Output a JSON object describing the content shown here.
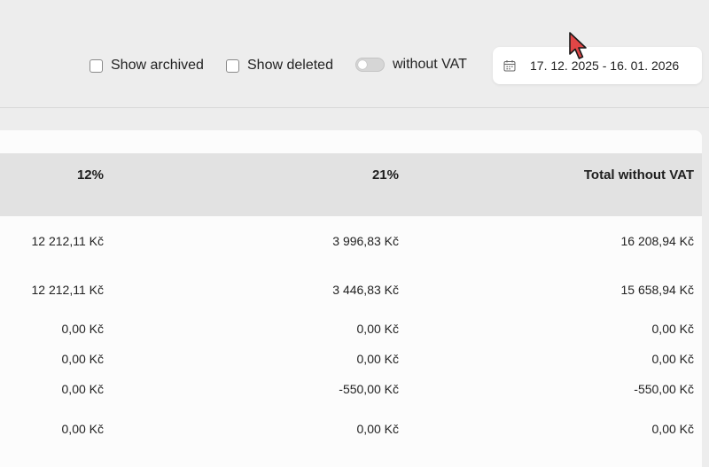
{
  "filters": {
    "show_archived": {
      "label": "Show archived",
      "checked": false
    },
    "show_deleted": {
      "label": "Show deleted",
      "checked": false
    },
    "without_vat": {
      "label": "without VAT",
      "enabled": false
    }
  },
  "date_range": {
    "value": "17. 12. 2025 - 16. 01. 2026",
    "icon": "calendar-icon"
  },
  "table": {
    "columns": [
      "12%",
      "21%",
      "Total without VAT"
    ],
    "rows": [
      [
        "12 212,11 Kč",
        "3 996,83 Kč",
        "16 208,94 Kč"
      ],
      [
        "12 212,11 Kč",
        "3 446,83 Kč",
        "15 658,94 Kč"
      ],
      [
        "0,00 Kč",
        "0,00 Kč",
        "0,00 Kč"
      ],
      [
        "0,00 Kč",
        "0,00 Kč",
        "0,00 Kč"
      ],
      [
        "0,00 Kč",
        "-550,00 Kč",
        "-550,00 Kč"
      ],
      [
        "0,00 Kč",
        "0,00 Kč",
        "0,00 Kč"
      ]
    ]
  },
  "colors": {
    "background": "#ededed",
    "header_row": "#e2e2e2",
    "card": "#fcfcfc",
    "cursor": "#e04646"
  }
}
